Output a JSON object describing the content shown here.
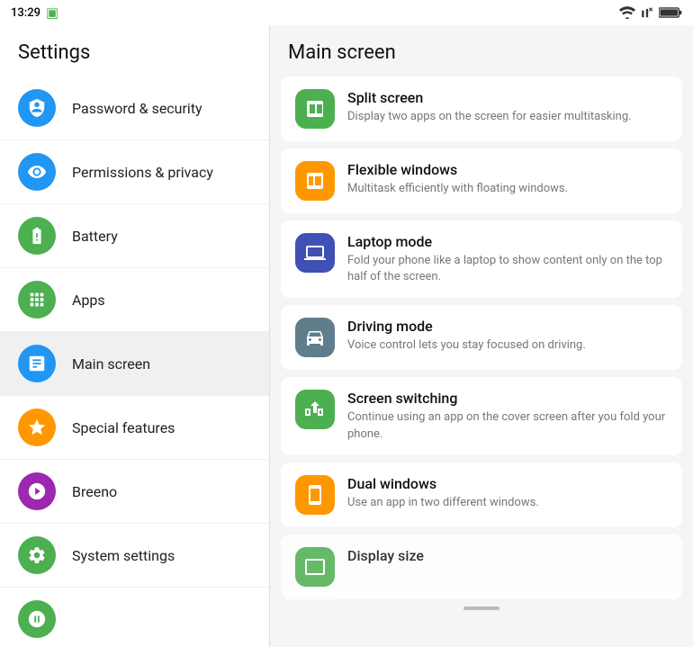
{
  "statusBar": {
    "time": "13:29",
    "appIcon": "▣",
    "wifi": "wifi",
    "signal": "signal",
    "battery": "battery"
  },
  "sidebar": {
    "title": "Settings",
    "items": [
      {
        "id": "password-security",
        "label": "Password & security",
        "iconColor": "#1565C0",
        "iconBg": "#2196F3"
      },
      {
        "id": "permissions-privacy",
        "label": "Permissions & privacy",
        "iconColor": "#1565C0",
        "iconBg": "#2196F3"
      },
      {
        "id": "battery",
        "label": "Battery",
        "iconColor": "#2E7D32",
        "iconBg": "#4CAF50"
      },
      {
        "id": "apps",
        "label": "Apps",
        "iconColor": "#2E7D32",
        "iconBg": "#4CAF50"
      },
      {
        "id": "main-screen",
        "label": "Main screen",
        "iconColor": "#1565C0",
        "iconBg": "#2196F3",
        "active": true
      },
      {
        "id": "special-features",
        "label": "Special features",
        "iconColor": "#E65100",
        "iconBg": "#FF9800"
      },
      {
        "id": "breeno",
        "label": "Breeno",
        "iconColor": "#6A1B9A",
        "iconBg": "#9C27B0"
      },
      {
        "id": "system-settings",
        "label": "System settings",
        "iconColor": "#2E7D32",
        "iconBg": "#4CAF50"
      }
    ]
  },
  "content": {
    "title": "Main screen",
    "items": [
      {
        "id": "split-screen",
        "title": "Split screen",
        "desc": "Display two apps on the screen for easier multitasking.",
        "iconBg": "#4CAF50"
      },
      {
        "id": "flexible-windows",
        "title": "Flexible windows",
        "desc": "Multitask efficiently with floating windows.",
        "iconBg": "#FF9800"
      },
      {
        "id": "laptop-mode",
        "title": "Laptop mode",
        "desc": "Fold your phone like a laptop to show content only on the top half of the screen.",
        "iconBg": "#3F51B5"
      },
      {
        "id": "driving-mode",
        "title": "Driving mode",
        "desc": "Voice control lets you stay focused on driving.",
        "iconBg": "#607D8B"
      },
      {
        "id": "screen-switching",
        "title": "Screen switching",
        "desc": "Continue using an app on the cover screen after you fold your phone.",
        "iconBg": "#4CAF50"
      },
      {
        "id": "dual-windows",
        "title": "Dual windows",
        "desc": "Use an app in two different windows.",
        "iconBg": "#FF9800"
      },
      {
        "id": "display-size",
        "title": "Display size",
        "desc": "",
        "iconBg": "#4CAF50"
      }
    ]
  }
}
